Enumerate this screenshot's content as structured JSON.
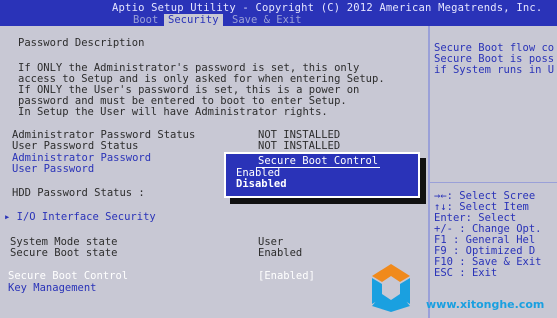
{
  "window": {
    "title": "Aptio Setup Utility - Copyright (C) 2012 American Megatrends, Inc.",
    "tabs": [
      "Boot",
      "Security",
      "Save & Exit"
    ],
    "active_tab": "Security"
  },
  "main": {
    "section_title": "Password Description",
    "description_lines": [
      "If ONLY the Administrator's password is set, this only",
      "access to Setup and is only asked for when entering Setup.",
      "If ONLY the User's password is set, this is a power on",
      "password and must be entered to boot to enter Setup.",
      "In Setup the User will have Administrator rights."
    ],
    "rows": [
      {
        "label": "Administrator Password Status",
        "value": "NOT INSTALLED"
      },
      {
        "label": "User Password Status",
        "value": "NOT INSTALLED"
      }
    ],
    "links": {
      "admin_password": "Administrator Password",
      "user_password": "User Password"
    },
    "hdd_label": "HDD Password Status  :",
    "io_security": "▸ I/O Interface Security",
    "system_mode_label": "System Mode state",
    "system_mode_value": "User",
    "secure_boot_state_label": "Secure Boot state",
    "secure_boot_state_value": "Enabled",
    "secure_boot_control_label": "Secure Boot Control",
    "secure_boot_control_value": "[Enabled]",
    "key_management": "Key Management"
  },
  "popup": {
    "title": "Secure Boot Control",
    "options": [
      "Enabled",
      "Disabled"
    ],
    "selected": "Disabled"
  },
  "help": {
    "lines": [
      "Secure Boot flow co",
      "Secure Boot is poss",
      "if System runs in U"
    ],
    "keys": [
      {
        "key": "→←:",
        "desc": "Select Scree"
      },
      {
        "key": "↑↓:",
        "desc": "Select Item"
      },
      {
        "key": "Enter:",
        "desc": "Select"
      },
      {
        "key": "+/-  :",
        "desc": "Change Opt."
      },
      {
        "key": "F1   :",
        "desc": "General Hel"
      },
      {
        "key": "F9   :",
        "desc": "Optimized D"
      },
      {
        "key": "F10  :",
        "desc": "Save & Exit"
      },
      {
        "key": "ESC  :",
        "desc": "Exit"
      }
    ]
  },
  "watermark": {
    "url": "www.xitonghe.com"
  },
  "colors": {
    "bios_blue": "#2a33b8",
    "panel_gray": "#c8c8d4",
    "text_dark": "#2d2d2d",
    "watermark_cyan": "#1aa0e0",
    "watermark_orange": "#f08a1c"
  }
}
